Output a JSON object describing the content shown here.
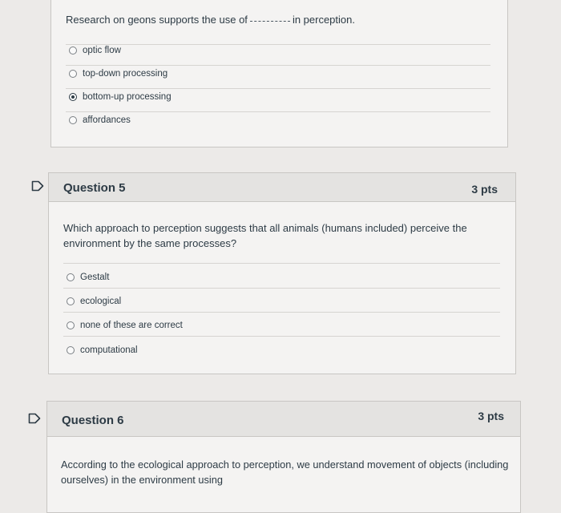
{
  "q4": {
    "stem_before": "Research on geons supports the use of",
    "stem_after": "in perception.",
    "answers": [
      {
        "label": "optic flow",
        "selected": false
      },
      {
        "label": "top-down processing",
        "selected": false
      },
      {
        "label": "bottom-up processing",
        "selected": true
      },
      {
        "label": "affordances",
        "selected": false
      }
    ]
  },
  "q5": {
    "title": "Question 5",
    "points": "3 pts",
    "text_line1": "Which approach to perception suggests that all animals (humans included) perceive the",
    "text_line2": "environment by the same processes?",
    "answers": [
      {
        "label": "Gestalt",
        "selected": false
      },
      {
        "label": "ecological",
        "selected": false
      },
      {
        "label": "none of these are correct",
        "selected": false
      },
      {
        "label": "computational",
        "selected": false
      }
    ]
  },
  "q6": {
    "title": "Question 6",
    "points": "3 pts",
    "text_line1": "According to the ecological approach to perception, we understand movement of objects (including",
    "text_line2": "ourselves) in the environment using"
  },
  "colors": {
    "flag": "#2d3b45",
    "background": "#eceae8",
    "card": "#f4f3f2"
  },
  "icons": {
    "flag": "flag-icon"
  }
}
